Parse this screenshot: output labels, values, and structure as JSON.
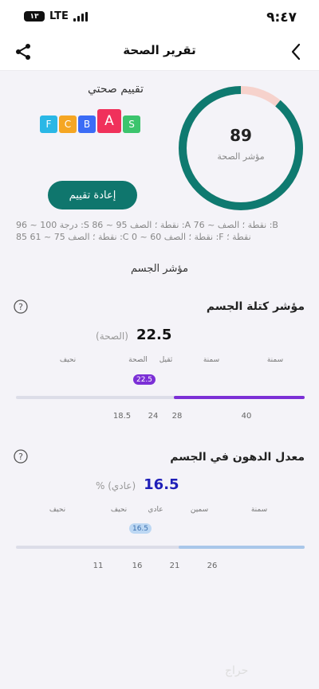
{
  "status_bar": {
    "time": "٩:٤٧",
    "network": "LTE",
    "battery": "١٣"
  },
  "header": {
    "title": "تقرير الصحة"
  },
  "health_score": {
    "value": "89",
    "label": "مؤشر الصحة",
    "score_fraction": 0.89
  },
  "grading": {
    "title": "تقييم صحتي",
    "grades": [
      {
        "letter": "F",
        "color": "#2ab7e6"
      },
      {
        "letter": "C",
        "color": "#f5a623"
      },
      {
        "letter": "B",
        "color": "#3b6cf6"
      },
      {
        "letter": "A",
        "color": "#f0315b"
      },
      {
        "letter": "S",
        "color": "#3cc46d"
      }
    ],
    "active_grade": "A"
  },
  "reassess_button": "إعادة تقييم",
  "grade_ranges": {
    "line1": "درجة 100 ~ 96 :S نقطة ؛ الصف 95 ~ 86 :A نقطة ؛ الصف ~ 76 :B",
    "line2": "85 نقطة ؛ الصف 75 ~ 61 :C نقطة ؛ الصف 60 ~ 0 :F نقطة ؛"
  },
  "body_index_title": "مؤشر الجسم",
  "bmi": {
    "title": "مؤشر كتلة الجسم",
    "value": "22.5",
    "unit": "(الصحة)",
    "categories": [
      "سمنة",
      "سمنة",
      "ثقيل",
      "الصحة",
      "نحيف"
    ],
    "badge": "22.5",
    "ticks": [
      "40",
      "28",
      "24",
      "18.5"
    ],
    "color": "#7b2fd6"
  },
  "body_fat": {
    "title": "معدل الدهون في الجسم",
    "value": "16.5",
    "unit": "% (عادي)",
    "categories": [
      "سمنة",
      "سمين",
      "عادي",
      "نحيف",
      "نحيف"
    ],
    "badge": "16.5",
    "ticks": [
      "26",
      "21",
      "16",
      "11"
    ],
    "color": "#1f1fb8"
  },
  "watermark": "حراج"
}
